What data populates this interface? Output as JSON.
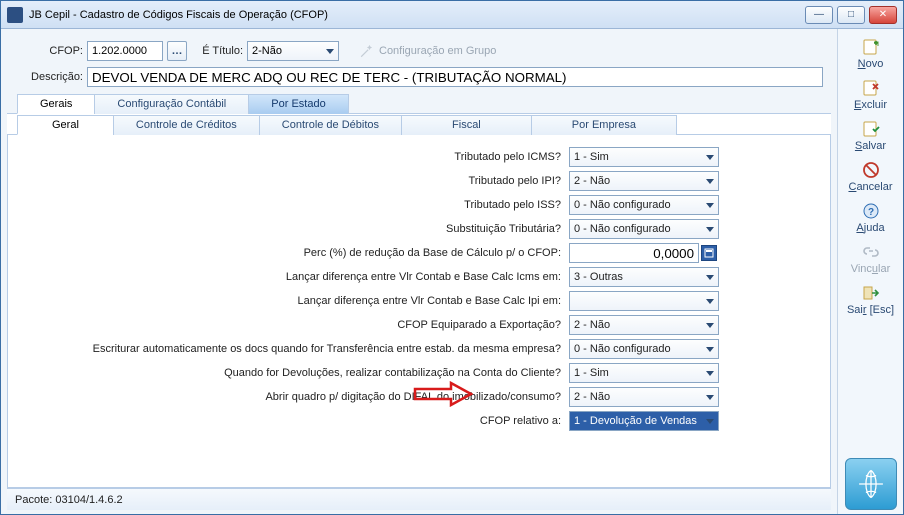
{
  "window": {
    "title": "JB Cepil - Cadastro de Códigos Fiscais de Operação (CFOP)"
  },
  "header": {
    "label_cfop": "CFOP:",
    "cfop_value": "1.202.0000",
    "label_etitulo": "É Título:",
    "etitulo_value": "2-Não",
    "config_grupo": "Configuração em Grupo",
    "label_descricao": "Descrição:",
    "descricao_value": "DEVOL VENDA DE MERC ADQ OU REC DE TERC - (TRIBUTAÇÃO NORMAL)"
  },
  "tabs_main": {
    "gerais": "Gerais",
    "config_contabil": "Configuração Contábil",
    "por_estado": "Por Estado"
  },
  "tabs_sub": {
    "geral": "Geral",
    "controle_creditos": "Controle de Créditos",
    "controle_debitos": "Controle de Débitos",
    "fiscal": "Fiscal",
    "por_empresa": "Por Empresa"
  },
  "form": {
    "l_icms": "Tributado pelo ICMS?",
    "v_icms": "1 - Sim",
    "l_ipi": "Tributado pelo IPI?",
    "v_ipi": "2 - Não",
    "l_iss": "Tributado pelo ISS?",
    "v_iss": "0 - Não configurado",
    "l_subtrib": "Substituição Tributária?",
    "v_subtrib": "0 - Não configurado",
    "l_perc": "Perc (%) de redução da Base de Cálculo p/ o CFOP:",
    "v_perc": "0,0000",
    "l_dif_icms": "Lançar diferença entre Vlr Contab e Base Calc Icms em:",
    "v_dif_icms": "3 - Outras",
    "l_dif_ipi": "Lançar diferença entre Vlr Contab e Base Calc Ipi em:",
    "v_dif_ipi": "",
    "l_export": "CFOP Equiparado a Exportação?",
    "v_export": "2 - Não",
    "l_escriturar": "Escriturar automaticamente os docs quando for Transferência entre estab. da mesma empresa?",
    "v_escriturar": "0 - Não configurado",
    "l_devol": "Quando for Devoluções, realizar contabilização na Conta do Cliente?",
    "v_devol": "1 - Sim",
    "l_difal": "Abrir quadro p/ digitação do DIFAL do imobilizado/consumo?",
    "v_difal": "2 - Não",
    "l_relativo": "CFOP relativo a:",
    "v_relativo": "1 - Devolução de Vendas"
  },
  "sidebar": {
    "novo": "Novo",
    "excluir": "Excluir",
    "salvar": "Salvar",
    "cancelar": "Cancelar",
    "ajuda": "Ajuda",
    "vincular": "Vincular",
    "sair": "Sair [Esc]"
  },
  "status": {
    "pacote": "Pacote: 03104/1.4.6.2"
  }
}
